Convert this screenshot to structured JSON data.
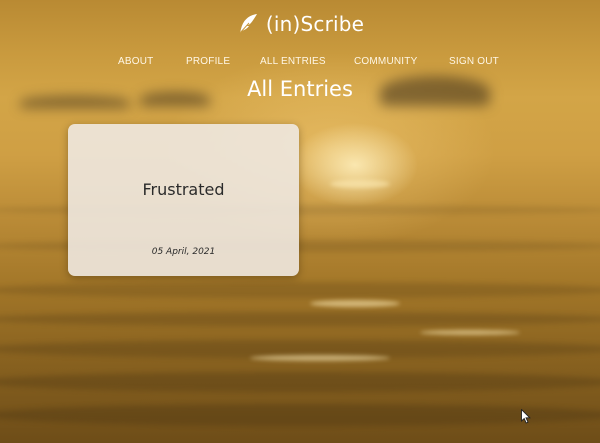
{
  "brand": {
    "logo_icon": "feather-icon",
    "name": "(in)Scribe"
  },
  "nav": {
    "items": [
      {
        "label": "ABOUT"
      },
      {
        "label": "PROFILE"
      },
      {
        "label": "ALL ENTRIES"
      },
      {
        "label": "COMMUNITY"
      },
      {
        "label": "SIGN OUT"
      }
    ]
  },
  "page": {
    "title": "All Entries"
  },
  "entries": [
    {
      "title": "Frustrated",
      "date": "05 April, 2021"
    }
  ],
  "colors": {
    "text_light": "#ffffff",
    "card_bg": "#eee8e0",
    "card_text": "#2b2b2b",
    "background_accent": "#d3a547"
  },
  "pointer": {
    "icon": "mouse-pointer-icon"
  }
}
